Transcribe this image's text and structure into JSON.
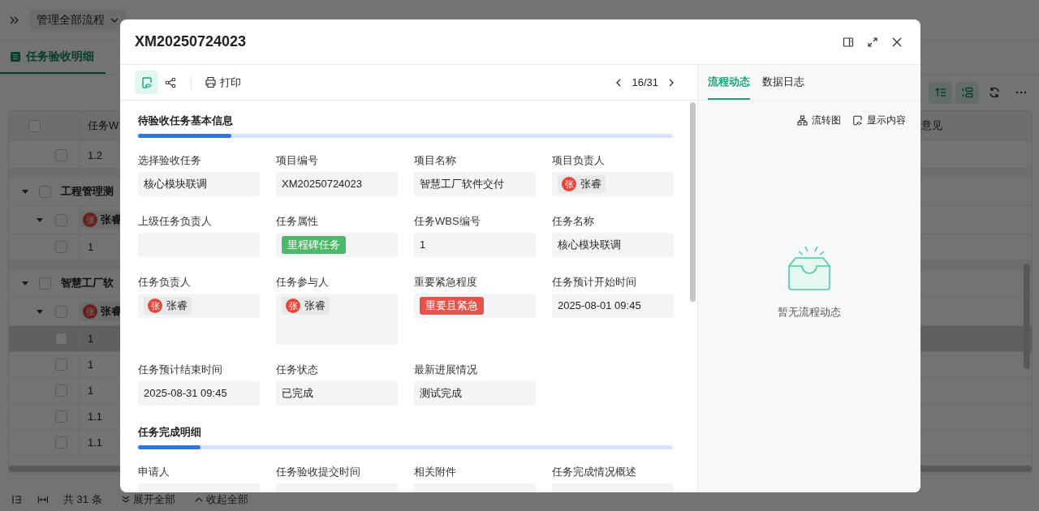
{
  "page": {
    "view_select": "管理全部流程",
    "tab": {
      "label": "任务验收明细",
      "selected": true
    },
    "table": {
      "header_left": "任务W",
      "header_right": "意见",
      "all_checked": false,
      "rows": [
        {
          "kind": "item",
          "text": "1.2",
          "checked": false,
          "selected": false
        },
        {
          "kind": "gap"
        },
        {
          "kind": "group",
          "text": "工程管理测",
          "expanded": true,
          "checked": false
        },
        {
          "kind": "person",
          "avatar": "张",
          "text": "张睿",
          "expanded": true,
          "checked": false
        },
        {
          "kind": "item",
          "text": "1",
          "checked": false,
          "selected": false
        },
        {
          "kind": "gap"
        },
        {
          "kind": "group",
          "text": "智慧工厂软",
          "expanded": true,
          "checked": false
        },
        {
          "kind": "person",
          "avatar": "张",
          "text": "张睿",
          "expanded": true,
          "checked": false
        },
        {
          "kind": "item",
          "text": "1",
          "checked": false,
          "selected": true
        },
        {
          "kind": "item",
          "text": "1",
          "checked": false,
          "selected": false
        },
        {
          "kind": "item",
          "text": "1",
          "checked": false,
          "selected": false
        },
        {
          "kind": "item",
          "text": "1.1",
          "checked": false,
          "selected": false
        },
        {
          "kind": "item",
          "text": "1.1",
          "checked": false,
          "selected": false
        }
      ]
    },
    "footer": {
      "total": "共 31 条",
      "expand_all": "展开全部",
      "collapse_all": "收起全部"
    }
  },
  "dialog": {
    "title": "XM20250724023",
    "print": "打印",
    "pager": "16/31",
    "view_selected": true,
    "sections": [
      {
        "title": "待验收任务基本信息",
        "fields": [
          {
            "label": "选择验收任务",
            "kind": "text",
            "value": "核心模块联调",
            "tall": false
          },
          {
            "label": "项目编号",
            "kind": "text",
            "value": "XM20250724023",
            "tall": false
          },
          {
            "label": "项目名称",
            "kind": "text",
            "value": "智慧工厂软件交付",
            "tall": false
          },
          {
            "label": "项目负责人",
            "kind": "person",
            "avatar": "张",
            "value": "张睿",
            "tall": false
          },
          {
            "label": "上级任务负责人",
            "kind": "empty",
            "tall": false
          },
          {
            "label": "任务属性",
            "kind": "tag",
            "value": "里程碑任务",
            "color": "#4cb868",
            "tall": false
          },
          {
            "label": "任务WBS编号",
            "kind": "text",
            "value": "1",
            "tall": false
          },
          {
            "label": "任务名称",
            "kind": "text",
            "value": "核心模块联调",
            "tall": false
          },
          {
            "label": "任务负责人",
            "kind": "person",
            "avatar": "张",
            "value": "张睿",
            "tall": false
          },
          {
            "label": "任务参与人",
            "kind": "person",
            "avatar": "张",
            "value": "张睿",
            "tall": true
          },
          {
            "label": "重要紧急程度",
            "kind": "tag",
            "value": "重要且紧急",
            "color": "#e5534b",
            "tall": false
          },
          {
            "label": "任务预计开始时间",
            "kind": "text",
            "value": "2025-08-01 09:45",
            "tall": false
          },
          {
            "label": "任务预计结束时间",
            "kind": "text",
            "value": "2025-08-31 09:45",
            "tall": false
          },
          {
            "label": "任务状态",
            "kind": "text",
            "value": "已完成",
            "tall": false
          },
          {
            "label": "最新进展情况",
            "kind": "text",
            "value": "测试完成",
            "tall": false
          }
        ]
      },
      {
        "title": "任务完成明细",
        "fields": [
          {
            "label": "申请人",
            "kind": "empty",
            "tall": false
          },
          {
            "label": "任务验收提交时间",
            "kind": "empty",
            "tall": false
          },
          {
            "label": "相关附件",
            "kind": "empty",
            "tall": false
          },
          {
            "label": "任务完成情况概述",
            "kind": "empty",
            "tall": false
          }
        ]
      }
    ],
    "side": {
      "tabs": [
        {
          "label": "流程动态",
          "selected": true
        },
        {
          "label": "数据日志",
          "selected": false
        }
      ],
      "actions": [
        "流转图",
        "显示内容"
      ],
      "empty_text": "暂无流程动态"
    }
  }
}
